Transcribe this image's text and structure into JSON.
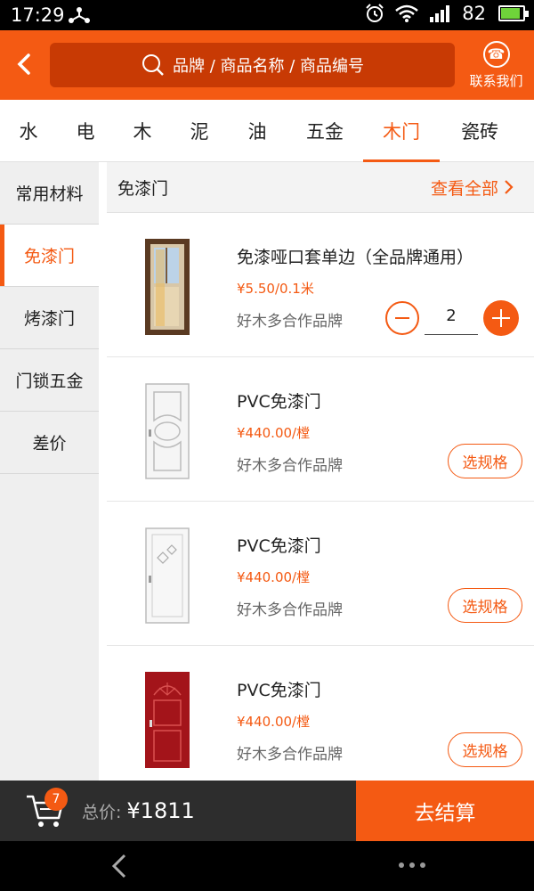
{
  "status_bar": {
    "time": "17:29",
    "battery": "82"
  },
  "header": {
    "search_placeholder": "品牌 / 商品名称 / 商品编号",
    "contact_label": "联系我们"
  },
  "category_tabs": [
    {
      "label": "水"
    },
    {
      "label": "电"
    },
    {
      "label": "木"
    },
    {
      "label": "泥"
    },
    {
      "label": "油"
    },
    {
      "label": "五金"
    },
    {
      "label": "木门",
      "active": true
    },
    {
      "label": "瓷砖"
    }
  ],
  "sidebar": [
    {
      "label": "常用材料"
    },
    {
      "label": "免漆门",
      "active": true
    },
    {
      "label": "烤漆门"
    },
    {
      "label": "门锁五金"
    },
    {
      "label": "差价"
    }
  ],
  "section": {
    "title": "免漆门",
    "view_all": "查看全部"
  },
  "products": [
    {
      "name": "免漆哑口套单边（全品牌通用）",
      "price": "¥5.50/0.1米",
      "brand": "好木多合作品牌",
      "quantity": "2",
      "image": "door-frame-window"
    },
    {
      "name": "PVC免漆门",
      "price": "¥440.00/樘",
      "brand": "好木多合作品牌",
      "spec_label": "选规格",
      "image": "white-arched-door"
    },
    {
      "name": "PVC免漆门",
      "price": "¥440.00/樘",
      "brand": "好木多合作品牌",
      "spec_label": "选规格",
      "image": "white-glass-door"
    },
    {
      "name": "PVC免漆门",
      "price": "¥440.00/樘",
      "brand": "好木多合作品牌",
      "spec_label": "选规格",
      "image": "red-door"
    }
  ],
  "cart": {
    "badge_count": "7",
    "total_label": "总价:",
    "total_value": "¥1811",
    "checkout_label": "去结算"
  },
  "colors": {
    "accent": "#f45a13",
    "dark": "#2d2d2d",
    "search_bg": "#c83a04"
  }
}
